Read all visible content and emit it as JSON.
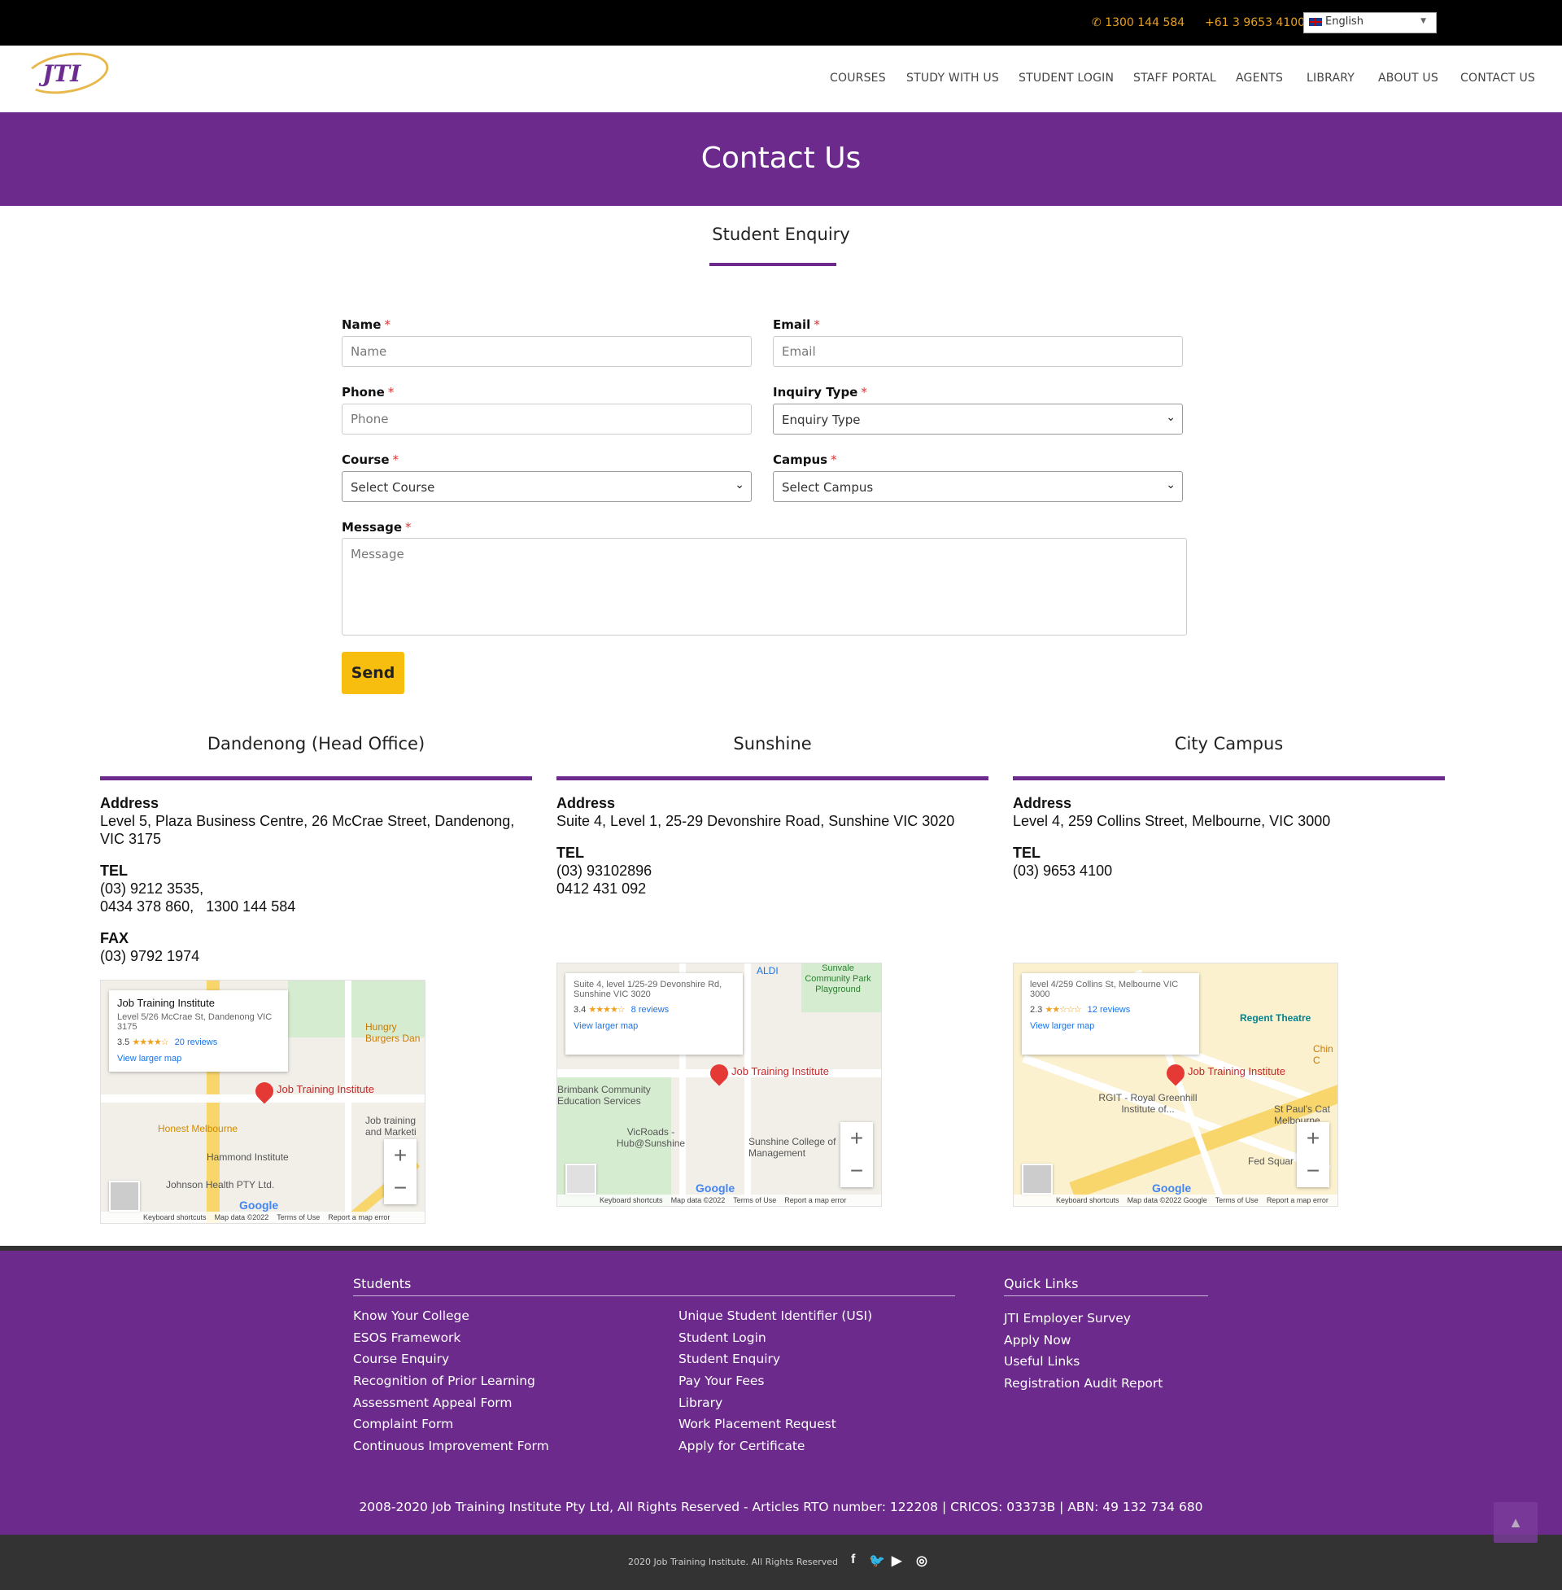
{
  "topbar": {
    "phone1": "1300 144 584",
    "phone2": "+61 3 9653 4100",
    "language": "English"
  },
  "header": {
    "logo_text": "JTI",
    "nav": [
      "COURSES",
      "STUDY WITH US",
      "STUDENT LOGIN",
      "STAFF PORTAL",
      "AGENTS",
      "LIBRARY",
      "ABOUT US",
      "CONTACT US"
    ]
  },
  "hero": {
    "title": "Contact Us"
  },
  "form": {
    "title": "Student Enquiry",
    "name_label": "Name",
    "name_placeholder": "Name",
    "email_label": "Email",
    "email_placeholder": "Email",
    "phone_label": "Phone",
    "phone_placeholder": "Phone",
    "inquiry_label": "Inquiry Type",
    "inquiry_value": "Enquiry Type",
    "course_label": "Course",
    "course_value": "Select Course",
    "campus_label": "Campus",
    "campus_value": "Select Campus",
    "message_label": "Message",
    "message_placeholder": "Message",
    "required_mark": "*",
    "send_label": "Send"
  },
  "campuses": [
    {
      "name": "Dandenong (Head Office)",
      "address_label": "Address",
      "address": "Level 5, Plaza Business Centre, 26 McCrae Street, Dandenong, VIC 3175",
      "tel_label": "TEL",
      "tel_lines": [
        "(03) 9212 3535,",
        "0434 378 860,   1300 144 584"
      ],
      "fax_label": "FAX",
      "fax": "(03) 9792 1974",
      "map": {
        "place": "Job Training Institute",
        "address": "Level 5/26 McCrae St, Dandenong VIC 3175",
        "rating": "3.5",
        "reviews": "20 reviews",
        "view_larger": "View larger map",
        "pin_label": "Job Training Institute",
        "pois": [
          "Honest Melbourne",
          "Hammond Institute",
          "Johnson Health PTY Ltd.",
          "Hungry Burgers Dan",
          "Job training and Marketi"
        ]
      }
    },
    {
      "name": "Sunshine",
      "address_label": "Address",
      "address": "Suite 4, Level 1, 25-29 Devonshire Road, Sunshine VIC 3020",
      "tel_label": "TEL",
      "tel_lines": [
        "(03) 93102896",
        "0412 431 092"
      ],
      "map": {
        "address": "Suite 4, level 1/25-29 Devonshire Rd, Sunshine VIC 3020",
        "rating": "3.4",
        "reviews": "8 reviews",
        "view_larger": "View larger map",
        "pin_label": "Job Training Institute",
        "pois": [
          "ALDI",
          "Sunvale Community Park Playground",
          "Brimbank Community Education Services",
          "VicRoads - Hub@Sunshine",
          "Sunshine College of Management"
        ]
      }
    },
    {
      "name": "City Campus",
      "address_label": "Address",
      "address": "Level 4, 259 Collins Street, Melbourne, VIC 3000",
      "tel_label": "TEL",
      "tel_lines": [
        "(03) 9653 4100"
      ],
      "map": {
        "address": "level 4/259 Collins St, Melbourne VIC 3000",
        "rating": "2.3",
        "reviews": "12 reviews",
        "view_larger": "View larger map",
        "pin_label": "Job Training Institute",
        "pois": [
          "Regent Theatre",
          "RGIT - Royal Greenhill Institute of...",
          "St Paul's Cat Melbourne",
          "Fed Squar",
          "Chin C"
        ]
      }
    }
  ],
  "map_footer": {
    "keyboard": "Keyboard shortcuts",
    "mapdata": "Map data ©2022",
    "mapdata_google": "Map data ©2022 Google",
    "terms": "Terms of Use",
    "report": "Report a map error",
    "google": "Google"
  },
  "footer": {
    "students_title": "Students",
    "quick_title": "Quick Links",
    "col1": [
      "Know Your College",
      "ESOS Framework",
      "Course Enquiry",
      "Recognition of Prior Learning",
      "Assessment Appeal Form",
      "Complaint Form",
      "Continuous Improvement Form"
    ],
    "col2": [
      "Unique Student Identifier (USI)",
      "Student Login",
      "Student Enquiry",
      "Pay Your Fees",
      "Library",
      "Work Placement Request",
      "Apply for Certificate"
    ],
    "quick": [
      "JTI Employer Survey",
      "Apply Now",
      "Useful Links",
      "Registration Audit Report"
    ],
    "copyright": "2008-2020 Job Training Institute Pty Ltd, All Rights Reserved - Articles RTO number: 122208 | CRICOS: 03373B | ABN: 49 132 734 680"
  },
  "bottom": {
    "copyright": "2020 Job Training Institute. All Rights Reserved",
    "social": [
      "facebook-icon",
      "twitter-icon",
      "youtube-icon",
      "instagram-icon"
    ]
  },
  "colors": {
    "brand_purple": "#6c2a8c",
    "accent_yellow": "#f7be0f"
  }
}
